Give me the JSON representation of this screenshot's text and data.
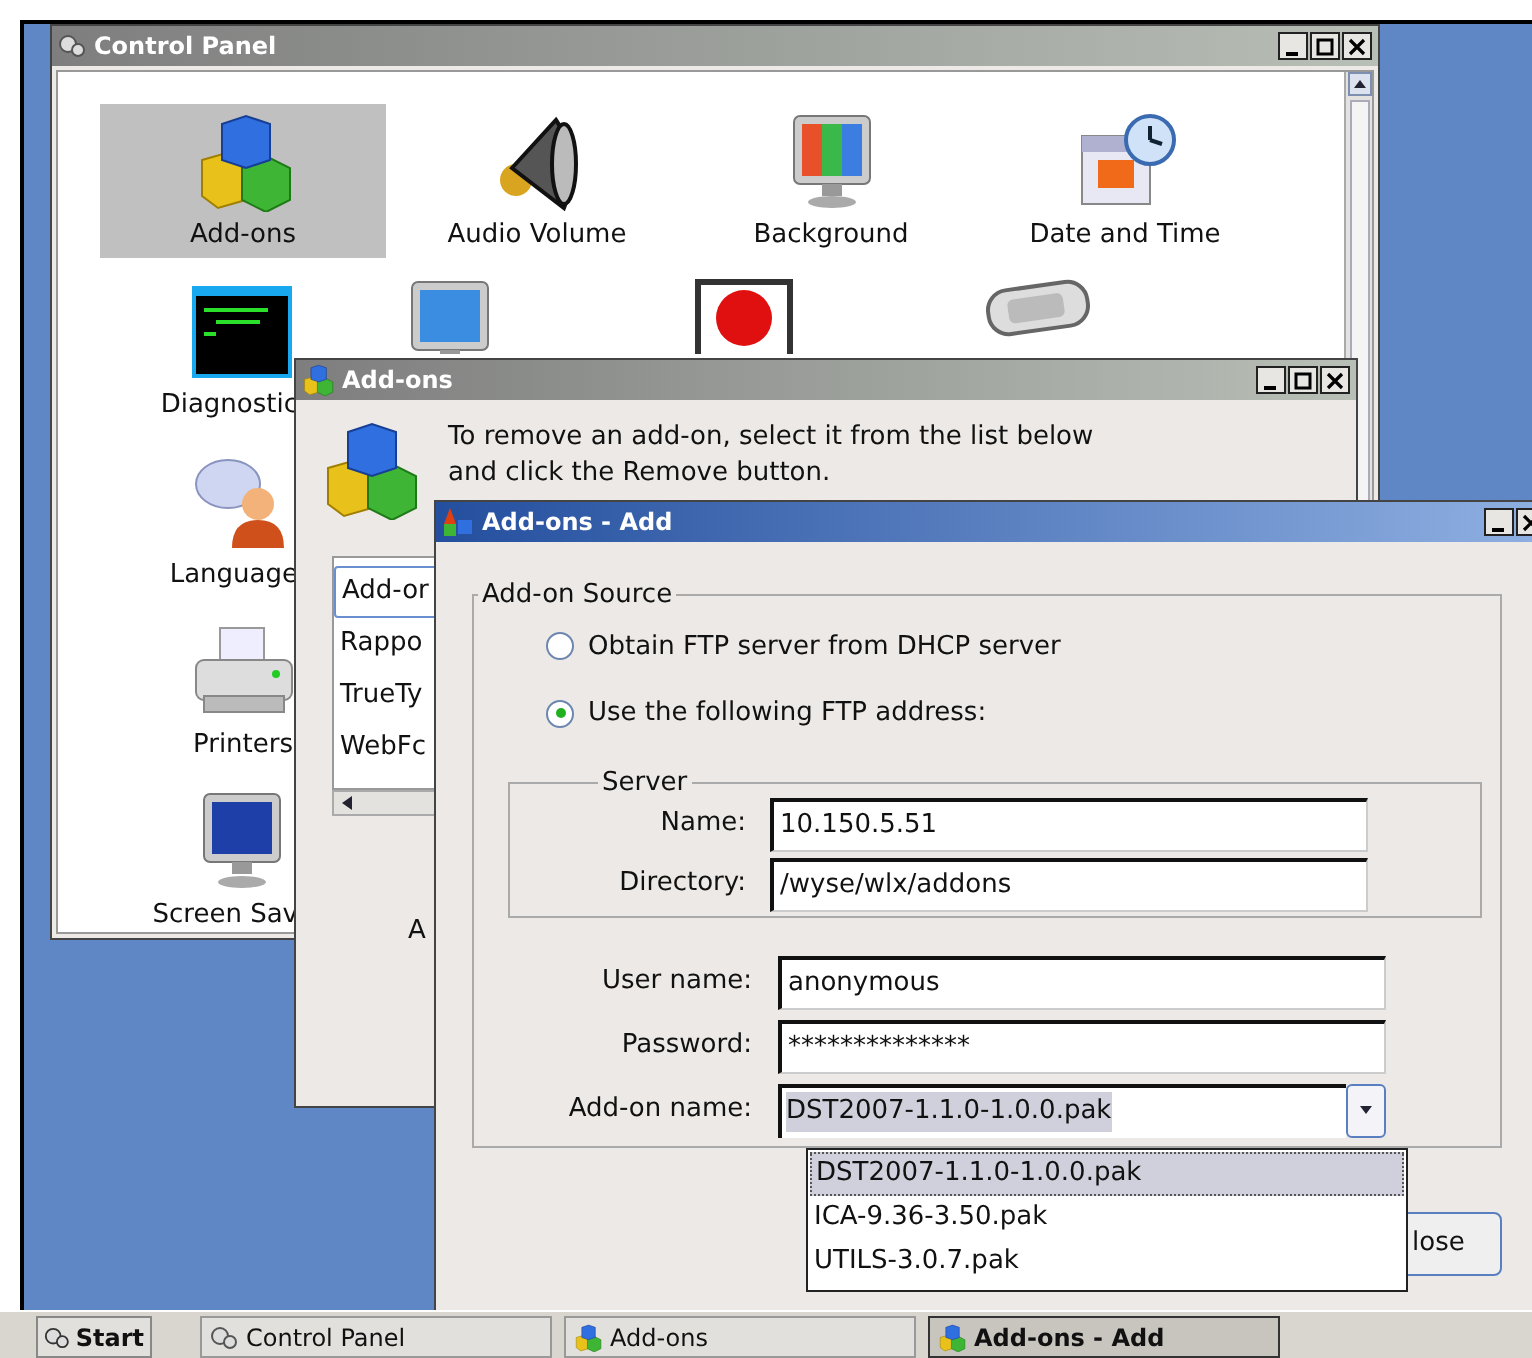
{
  "control_panel": {
    "title": "Control Panel",
    "rows": [
      [
        {
          "kind": "cubes",
          "label": "Add-ons",
          "selected": true,
          "clipped": false
        },
        {
          "kind": "speaker",
          "label": "Audio Volume",
          "selected": false,
          "clipped": false
        },
        {
          "kind": "color-monitor",
          "label": "Background",
          "selected": false,
          "clipped": false
        },
        {
          "kind": "calendar",
          "label": "Date and Time",
          "selected": false,
          "clipped": false
        }
      ],
      [
        {
          "kind": "terminal",
          "label": "Diagnostic",
          "selected": false,
          "clipped": true
        },
        {
          "kind": "monitor",
          "selected": false
        },
        {
          "kind": "record",
          "selected": false
        },
        {
          "kind": "keyboard",
          "selected": false
        }
      ],
      [
        {
          "kind": "chat",
          "label": "Language",
          "selected": false,
          "clipped": true
        }
      ],
      [
        {
          "kind": "printer",
          "label": "Printers",
          "selected": false,
          "clipped": false
        }
      ],
      [
        {
          "kind": "moon",
          "label": "Screen Sav",
          "selected": false,
          "clipped": true
        }
      ]
    ]
  },
  "addons_window": {
    "title": "Add-ons",
    "instructions": "To remove an add-on, select it from the list below and click the Remove button.",
    "list": [
      {
        "label": "Add-or",
        "selected": true
      },
      {
        "label": "Rappo",
        "selected": false
      },
      {
        "label": "TrueTy",
        "selected": false
      },
      {
        "label": "WebFc",
        "selected": false
      }
    ],
    "button_fragment": "A"
  },
  "add_dialog": {
    "title": "Add-ons - Add",
    "source_group": "Add-on Source",
    "options": [
      {
        "label": "Obtain FTP server from DHCP server",
        "selected": false
      },
      {
        "label": "Use the following FTP address:",
        "selected": true
      }
    ],
    "server_group": "Server",
    "server_fields": [
      {
        "label": "Name:",
        "value": "10.150.5.51"
      },
      {
        "label": "Directory:",
        "value": "/wyse/wlx/addons"
      }
    ],
    "fields": [
      {
        "label": "User name:",
        "value": "anonymous"
      },
      {
        "label": "Password:",
        "value": "**************"
      }
    ],
    "addon": {
      "label": "Add-on name:",
      "value": "DST2007-1.1.0-1.0.0.pak",
      "options": [
        {
          "label": "DST2007-1.1.0-1.0.0.pak",
          "selected": true
        },
        {
          "label": "ICA-9.36-3.50.pak",
          "selected": false
        },
        {
          "label": "UTILS-3.0.7.pak",
          "selected": false
        }
      ]
    },
    "close_button": "lose"
  },
  "taskbar": {
    "start": "Start",
    "tasks": [
      {
        "label": "Control Panel",
        "selected": false
      },
      {
        "label": "Add-ons",
        "selected": false
      },
      {
        "label": "Add-ons - Add",
        "selected": true
      }
    ]
  }
}
